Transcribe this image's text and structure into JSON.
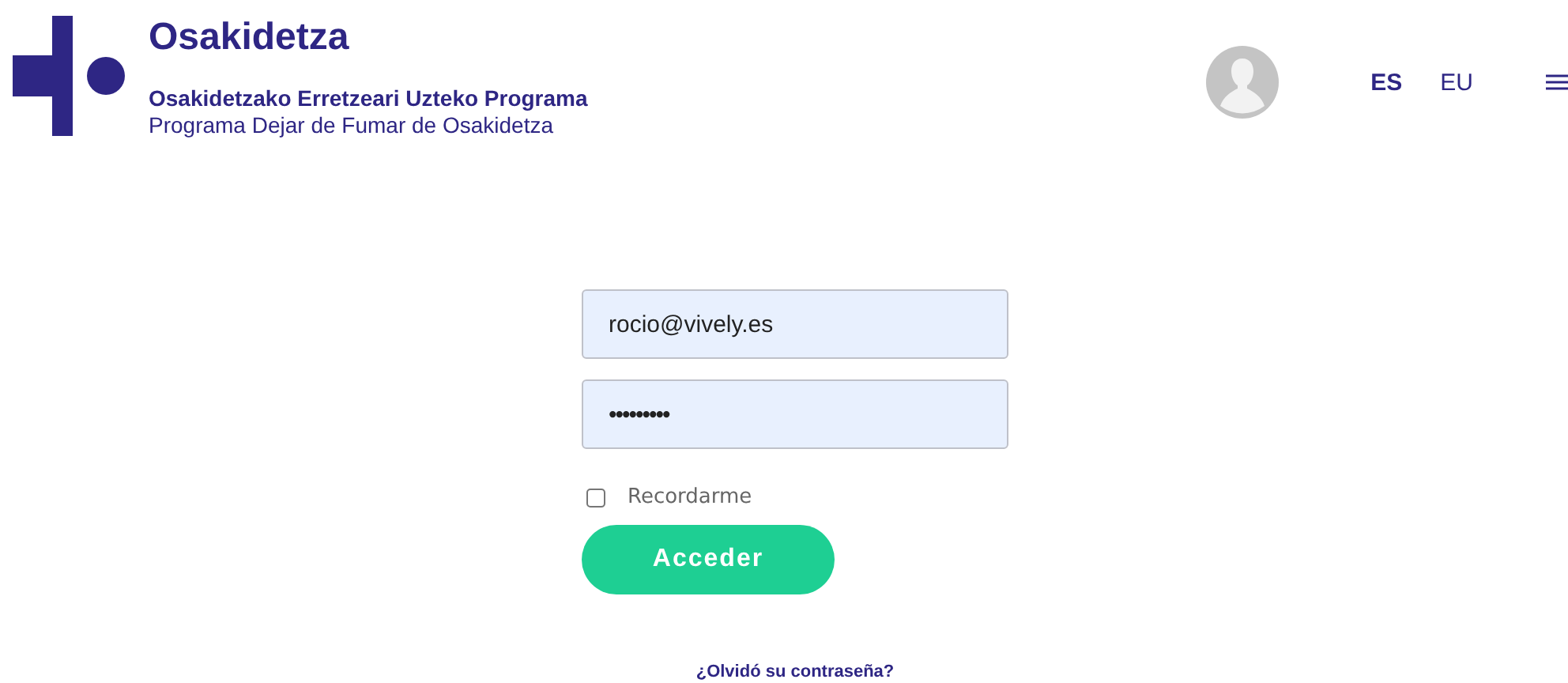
{
  "header": {
    "brand": "Osakidetza",
    "subtitle_eu": "Osakidetzako Erretzeari Uzteko Programa",
    "subtitle_es": "Programa Dejar de Fumar de Osakidetza",
    "languages": [
      {
        "label": "ES",
        "selected": true
      },
      {
        "label": "EU",
        "selected": false
      }
    ]
  },
  "login": {
    "email": "rocio@vively.es",
    "password": "•••••••••",
    "remember": {
      "label": "Recordarme",
      "checked": false
    },
    "submit": "Acceder",
    "forgot": "¿Olvidó su contraseña?"
  }
}
